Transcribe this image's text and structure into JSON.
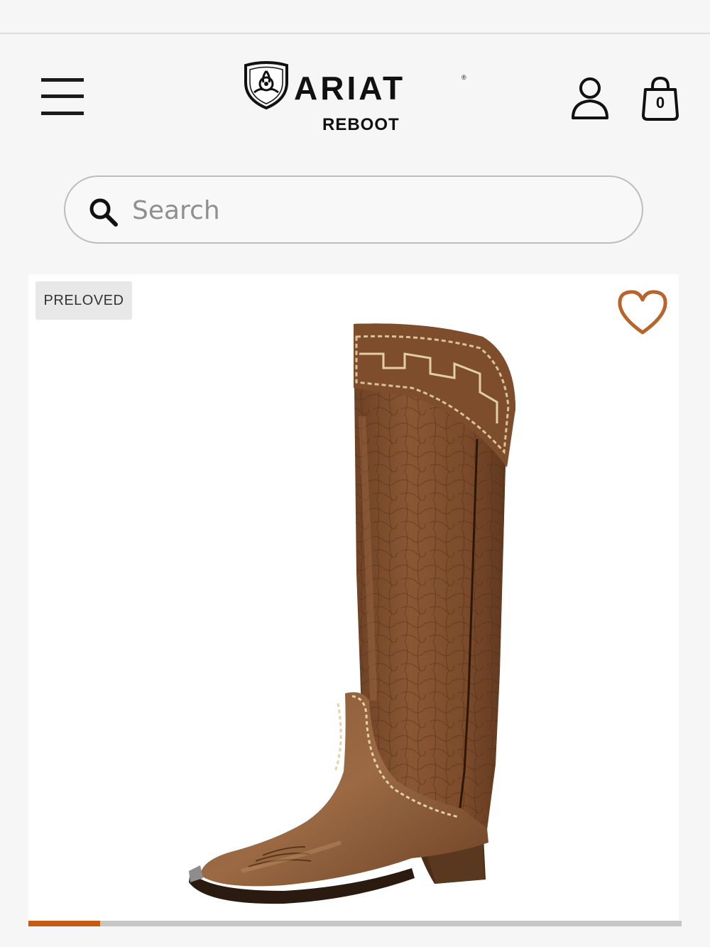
{
  "header": {
    "brand": "ARIAT",
    "brand_mark": "®",
    "sub_brand": "REBOOT",
    "menu_icon": "hamburger-menu-icon",
    "account_icon": "user-icon",
    "cart_icon": "shopping-bag-icon",
    "cart_count": "0"
  },
  "search": {
    "placeholder": "Search",
    "value": "",
    "icon": "search-icon"
  },
  "product": {
    "badge": "PRELOVED",
    "wishlist_icon": "heart-outline-icon",
    "image": "tall-brown-leather-western-boot"
  },
  "carousel": {
    "progress": 0.11
  },
  "colors": {
    "accent": "#c85b14",
    "heart": "#b8642a",
    "text": "#1a1a1a",
    "background": "#f6f6f6"
  }
}
